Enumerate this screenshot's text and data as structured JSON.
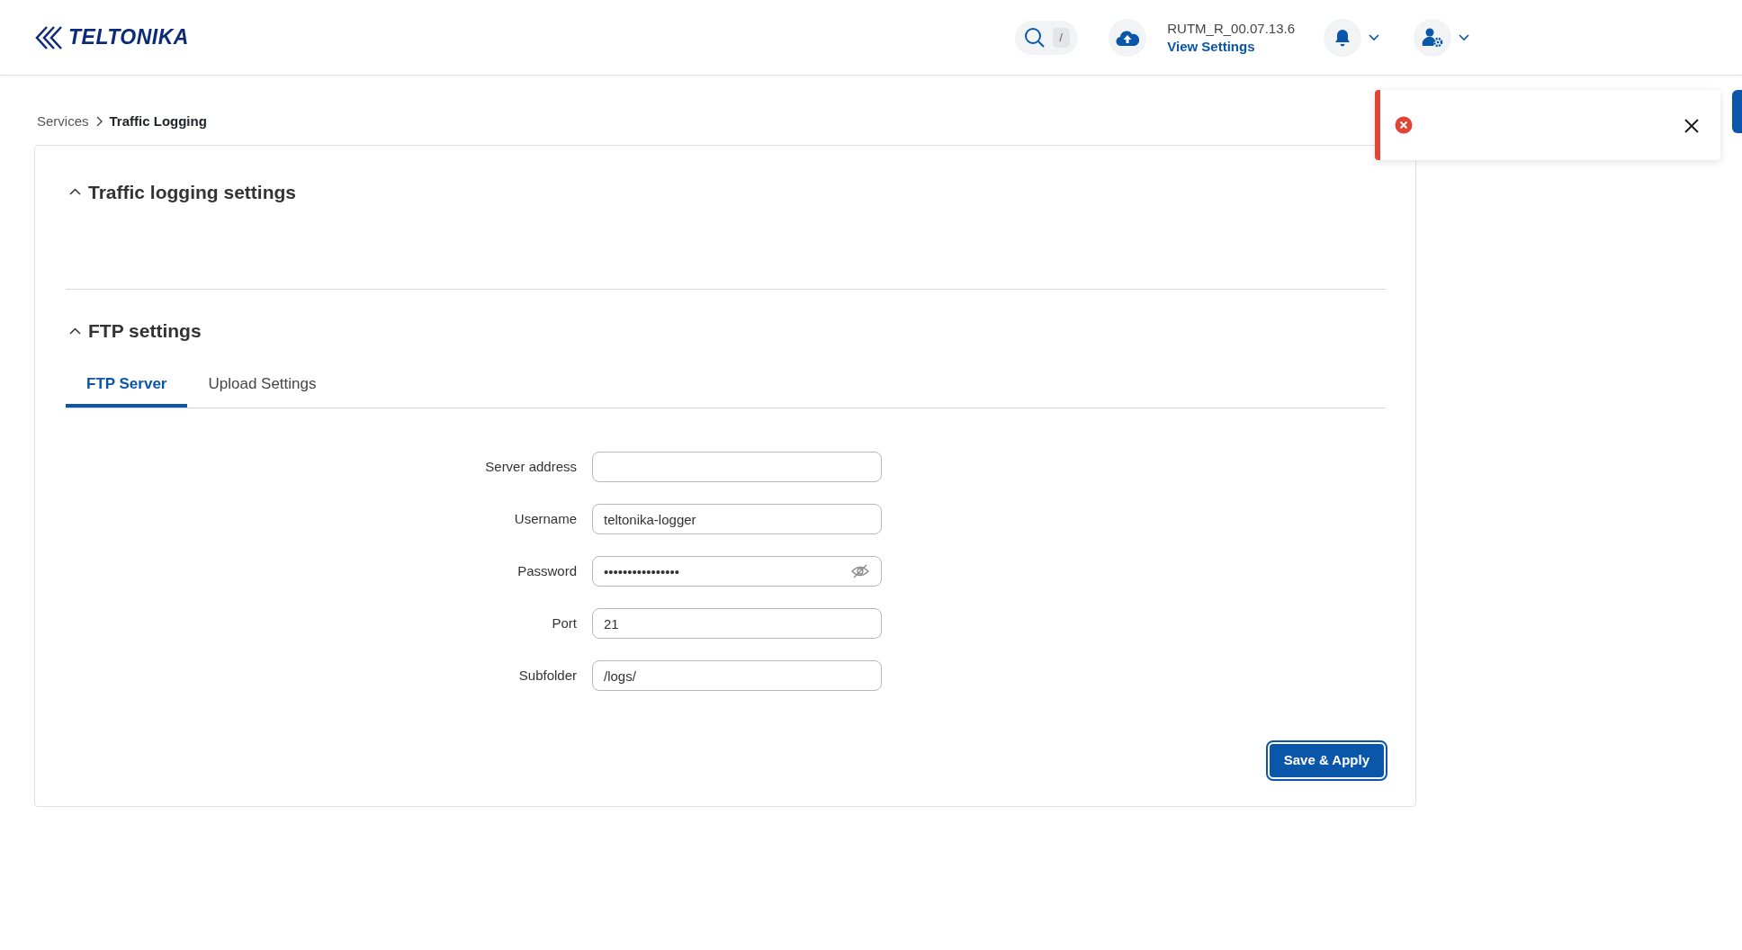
{
  "header": {
    "logo": "TELTONIKA",
    "search_shortcut": "/",
    "firmware": "RUTM_R_00.07.13.6",
    "firmware_link": "View Settings"
  },
  "breadcrumb": [
    {
      "label": "Services"
    },
    {
      "label": "Traffic Logging"
    }
  ],
  "sections": [
    {
      "title": "Traffic logging settings",
      "expanded": true
    },
    {
      "title": "FTP settings",
      "expanded": true
    }
  ],
  "tabs": [
    {
      "label": "FTP Server",
      "selected": true
    },
    {
      "label": "Upload Settings",
      "selected": false
    }
  ],
  "fields": [
    {
      "label": "Server address",
      "kind": "text"
    },
    {
      "label": "Username",
      "value": "teltonika-logger",
      "kind": "text"
    },
    {
      "label": "Password",
      "value": "••••••••••••••••",
      "kind": "password"
    },
    {
      "label": "Port",
      "value": "21",
      "kind": "text"
    },
    {
      "label": "Subfolder",
      "value": "/logs/",
      "kind": "text"
    }
  ],
  "save_button": "Save & Apply",
  "toast": {
    "kind": "error"
  }
}
